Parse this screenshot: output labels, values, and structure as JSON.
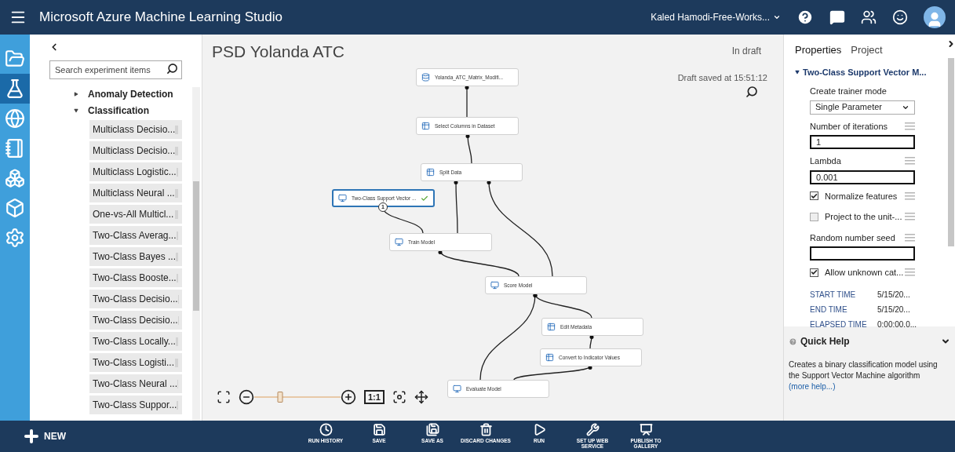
{
  "app_bar": {
    "title": "Microsoft Azure Machine Learning Studio",
    "user": "Kaled Hamodi-Free-Works..."
  },
  "nav_rail": [
    {
      "kind": "projects",
      "selected": false
    },
    {
      "kind": "experiments",
      "selected": true
    },
    {
      "kind": "web_services",
      "selected": false
    },
    {
      "kind": "notebooks",
      "selected": false
    },
    {
      "kind": "datasets",
      "selected": false
    },
    {
      "kind": "trained_models",
      "selected": false
    },
    {
      "kind": "settings",
      "selected": false
    }
  ],
  "palette": {
    "search": {
      "placeholder": "Search experiment items"
    },
    "tree": [
      {
        "label": "Anomaly Detection",
        "expanded": false
      },
      {
        "label": "Classification",
        "expanded": true,
        "children": [
          {
            "label": "Multiclass Decisio..."
          },
          {
            "label": "Multiclass Decisio..."
          },
          {
            "label": "Multiclass Logistic..."
          },
          {
            "label": "Multiclass Neural ..."
          },
          {
            "label": "One-vs-All Multicl..."
          },
          {
            "label": "Two-Class Averag..."
          },
          {
            "label": "Two-Class Bayes ..."
          },
          {
            "label": "Two-Class Booste..."
          },
          {
            "label": "Two-Class Decisio..."
          },
          {
            "label": "Two-Class Decisio..."
          },
          {
            "label": "Two-Class Locally..."
          },
          {
            "label": "Two-Class Logisti..."
          },
          {
            "label": "Two-Class Neural ..."
          },
          {
            "label": "Two-Class Suppor..."
          }
        ]
      }
    ]
  },
  "experiment": {
    "title": "PSD Yolanda ATC",
    "status": "In draft",
    "saved": "Draft saved at 15:51:12",
    "nodes": [
      {
        "label": "Yolanda_ATC_Matrix_Modifi...",
        "kind": "dataset",
        "selected": false
      },
      {
        "label": "Select Columns in Dataset",
        "kind": "transform",
        "selected": false
      },
      {
        "label": "Split Data",
        "kind": "transform",
        "selected": false
      },
      {
        "label": "Two-Class Support Vector ...",
        "kind": "model",
        "selected": true,
        "validated": true,
        "port_badge": "1"
      },
      {
        "label": "Train Model",
        "kind": "model",
        "selected": false
      },
      {
        "label": "Score Model",
        "kind": "model",
        "selected": false
      },
      {
        "label": "Edit Metadata",
        "kind": "transform",
        "selected": false
      },
      {
        "label": "Convert to Indicator Values",
        "kind": "transform",
        "selected": false
      },
      {
        "label": "Evaluate Model",
        "kind": "model",
        "selected": false
      }
    ],
    "zoom": {
      "level": 0.3,
      "reset_label": "1:1"
    }
  },
  "properties": {
    "tabs": [
      {
        "label": "Properties",
        "selected": true
      },
      {
        "label": "Project",
        "selected": false
      }
    ],
    "module": {
      "title": "Two-Class Support Vector M...",
      "expanded": true
    },
    "params": [
      {
        "kind": "select",
        "label": "Create trainer mode",
        "value": "Single Parameter"
      },
      {
        "kind": "input",
        "label": "Number of iterations",
        "value": "1"
      },
      {
        "kind": "input",
        "label": "Lambda",
        "value": "0.001"
      },
      {
        "kind": "checkbox",
        "label": "Normalize features",
        "checked": true
      },
      {
        "kind": "checkbox",
        "label": "Project to the unit-...",
        "checked": false
      },
      {
        "kind": "input",
        "label": "Random number seed"
      },
      {
        "kind": "checkbox",
        "label": "Allow unknown cat...",
        "checked": true
      }
    ],
    "run_info": [
      {
        "label": "START TIME",
        "value": "5/15/20..."
      },
      {
        "label": "END TIME",
        "value": "5/15/20..."
      },
      {
        "label": "ELAPSED TIME",
        "value": "0:00:00.0..."
      }
    ]
  },
  "quick_help": {
    "title": "Quick Help",
    "expanded": true,
    "text": "Creates a binary classification model using the Support Vector Machine algorithm",
    "link": "(more help...)"
  },
  "command_bar": {
    "new": "NEW",
    "commands": [
      {
        "kind": "history",
        "label": "RUN HISTORY"
      },
      {
        "kind": "save",
        "label": "SAVE"
      },
      {
        "kind": "save_as",
        "label": "SAVE AS"
      },
      {
        "kind": "discard",
        "label": "DISCARD CHANGES"
      },
      {
        "kind": "run",
        "label": "RUN"
      },
      {
        "kind": "web_service",
        "label": "SET UP WEB SERVICE"
      },
      {
        "kind": "publish",
        "label": "PUBLISH TO GALLERY"
      }
    ]
  }
}
